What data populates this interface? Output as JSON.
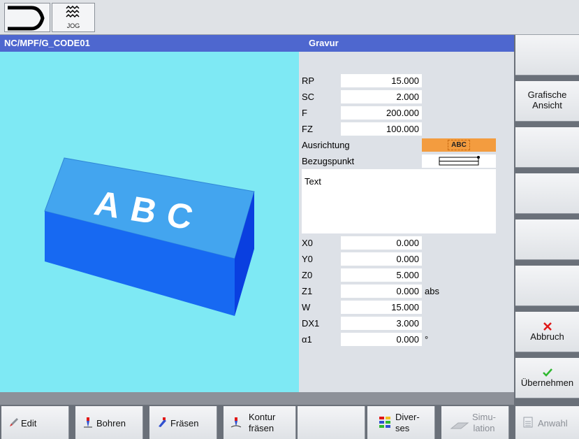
{
  "header": {
    "jog_label": "JOG",
    "left_title": "NC/MPF/G_CODE01",
    "right_title": "Gravur"
  },
  "graphic": {
    "block_text": "ABC",
    "colors": {
      "background": "#7ee9f4",
      "block_top": "#43a5ef",
      "block_front": "#1769f2",
      "block_side": "#0a3fe0"
    }
  },
  "params_top": [
    {
      "label": "RP",
      "value": "15.000"
    },
    {
      "label": "SC",
      "value": "2.000"
    },
    {
      "label": "F",
      "value": "200.000"
    },
    {
      "label": "FZ",
      "value": "100.000"
    }
  ],
  "ausrichtung": {
    "label": "Ausrichtung",
    "value": "ABC"
  },
  "bezugspunkt": {
    "label": "Bezugspunkt"
  },
  "text_field": {
    "label": "Text"
  },
  "params_bottom": [
    {
      "label": "X0",
      "value": "0.000",
      "unit": ""
    },
    {
      "label": "Y0",
      "value": "0.000",
      "unit": ""
    },
    {
      "label": "Z0",
      "value": "5.000",
      "unit": ""
    },
    {
      "label": "Z1",
      "value": "0.000",
      "unit": "abs"
    },
    {
      "label": "W",
      "value": "15.000",
      "unit": ""
    },
    {
      "label": "DX1",
      "value": "3.000",
      "unit": ""
    },
    {
      "label": "α1",
      "value": "0.000",
      "unit": "°"
    }
  ],
  "vertical_softkeys": {
    "grafische_line1": "Grafische",
    "grafische_line2": "Ansicht",
    "abbruch": "Abbruch",
    "uebernehmen": "Übernehmen"
  },
  "horizontal_softkeys": {
    "edit": "Edit",
    "bohren": "Bohren",
    "fraesen": "Fräsen",
    "kontur_line1": "Kontur",
    "kontur_line2": "fräsen",
    "diverses_line1": "Diver-",
    "diverses_line2": "ses",
    "simulation_line1": "Simu-",
    "simulation_line2": "lation",
    "anwahl": "Anwahl"
  }
}
